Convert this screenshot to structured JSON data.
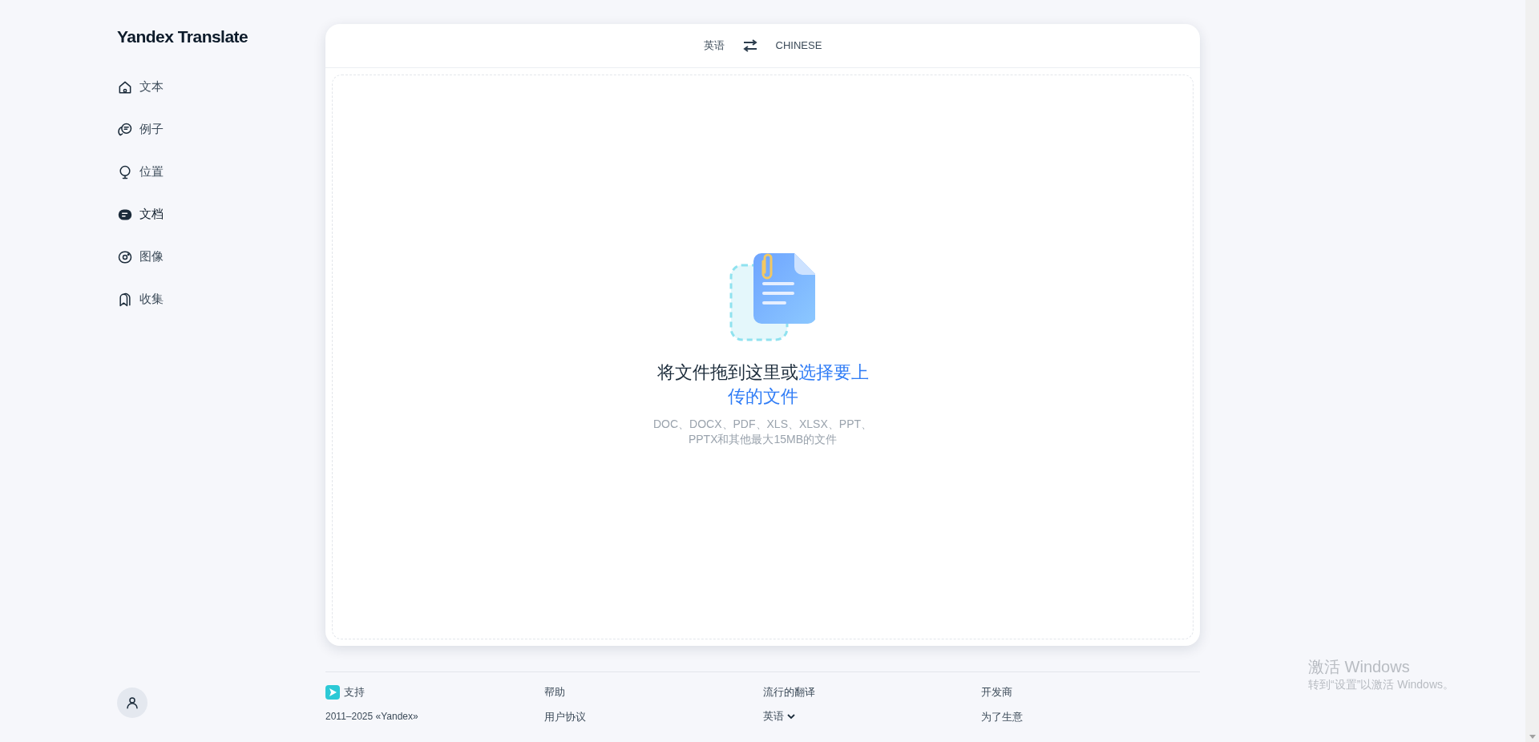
{
  "logo": "Yandex Translate",
  "nav": [
    {
      "kind": "home",
      "label": "文本",
      "selected": false
    },
    {
      "kind": "chat",
      "label": "例子",
      "selected": false
    },
    {
      "kind": "pin",
      "label": "位置",
      "selected": false
    },
    {
      "kind": "doc",
      "label": "文档",
      "selected": true
    },
    {
      "kind": "camera",
      "label": "图像",
      "selected": false
    },
    {
      "kind": "bookmark",
      "label": "收集",
      "selected": false
    }
  ],
  "languages": {
    "source": "英语",
    "target": "CHINESE"
  },
  "dropzone": {
    "prompt": "将文件拖到这里或",
    "link": [
      "选择要上",
      "传的文件"
    ],
    "formats": "DOC、DOCX、PDF、XLS、XLSX、PPT、PPTX和其他最大15MB的文件"
  },
  "footer": {
    "columns": [
      [
        "支持",
        "2011–2025 «Yandex»"
      ],
      [
        "帮助",
        "用户协议"
      ],
      [
        "流行的翻译",
        "英语"
      ],
      [
        "开发商",
        "为了生意"
      ]
    ]
  },
  "os_notice": {
    "title": "激活 Windows",
    "subtitle": "转到“设置”以激活 Windows。"
  }
}
